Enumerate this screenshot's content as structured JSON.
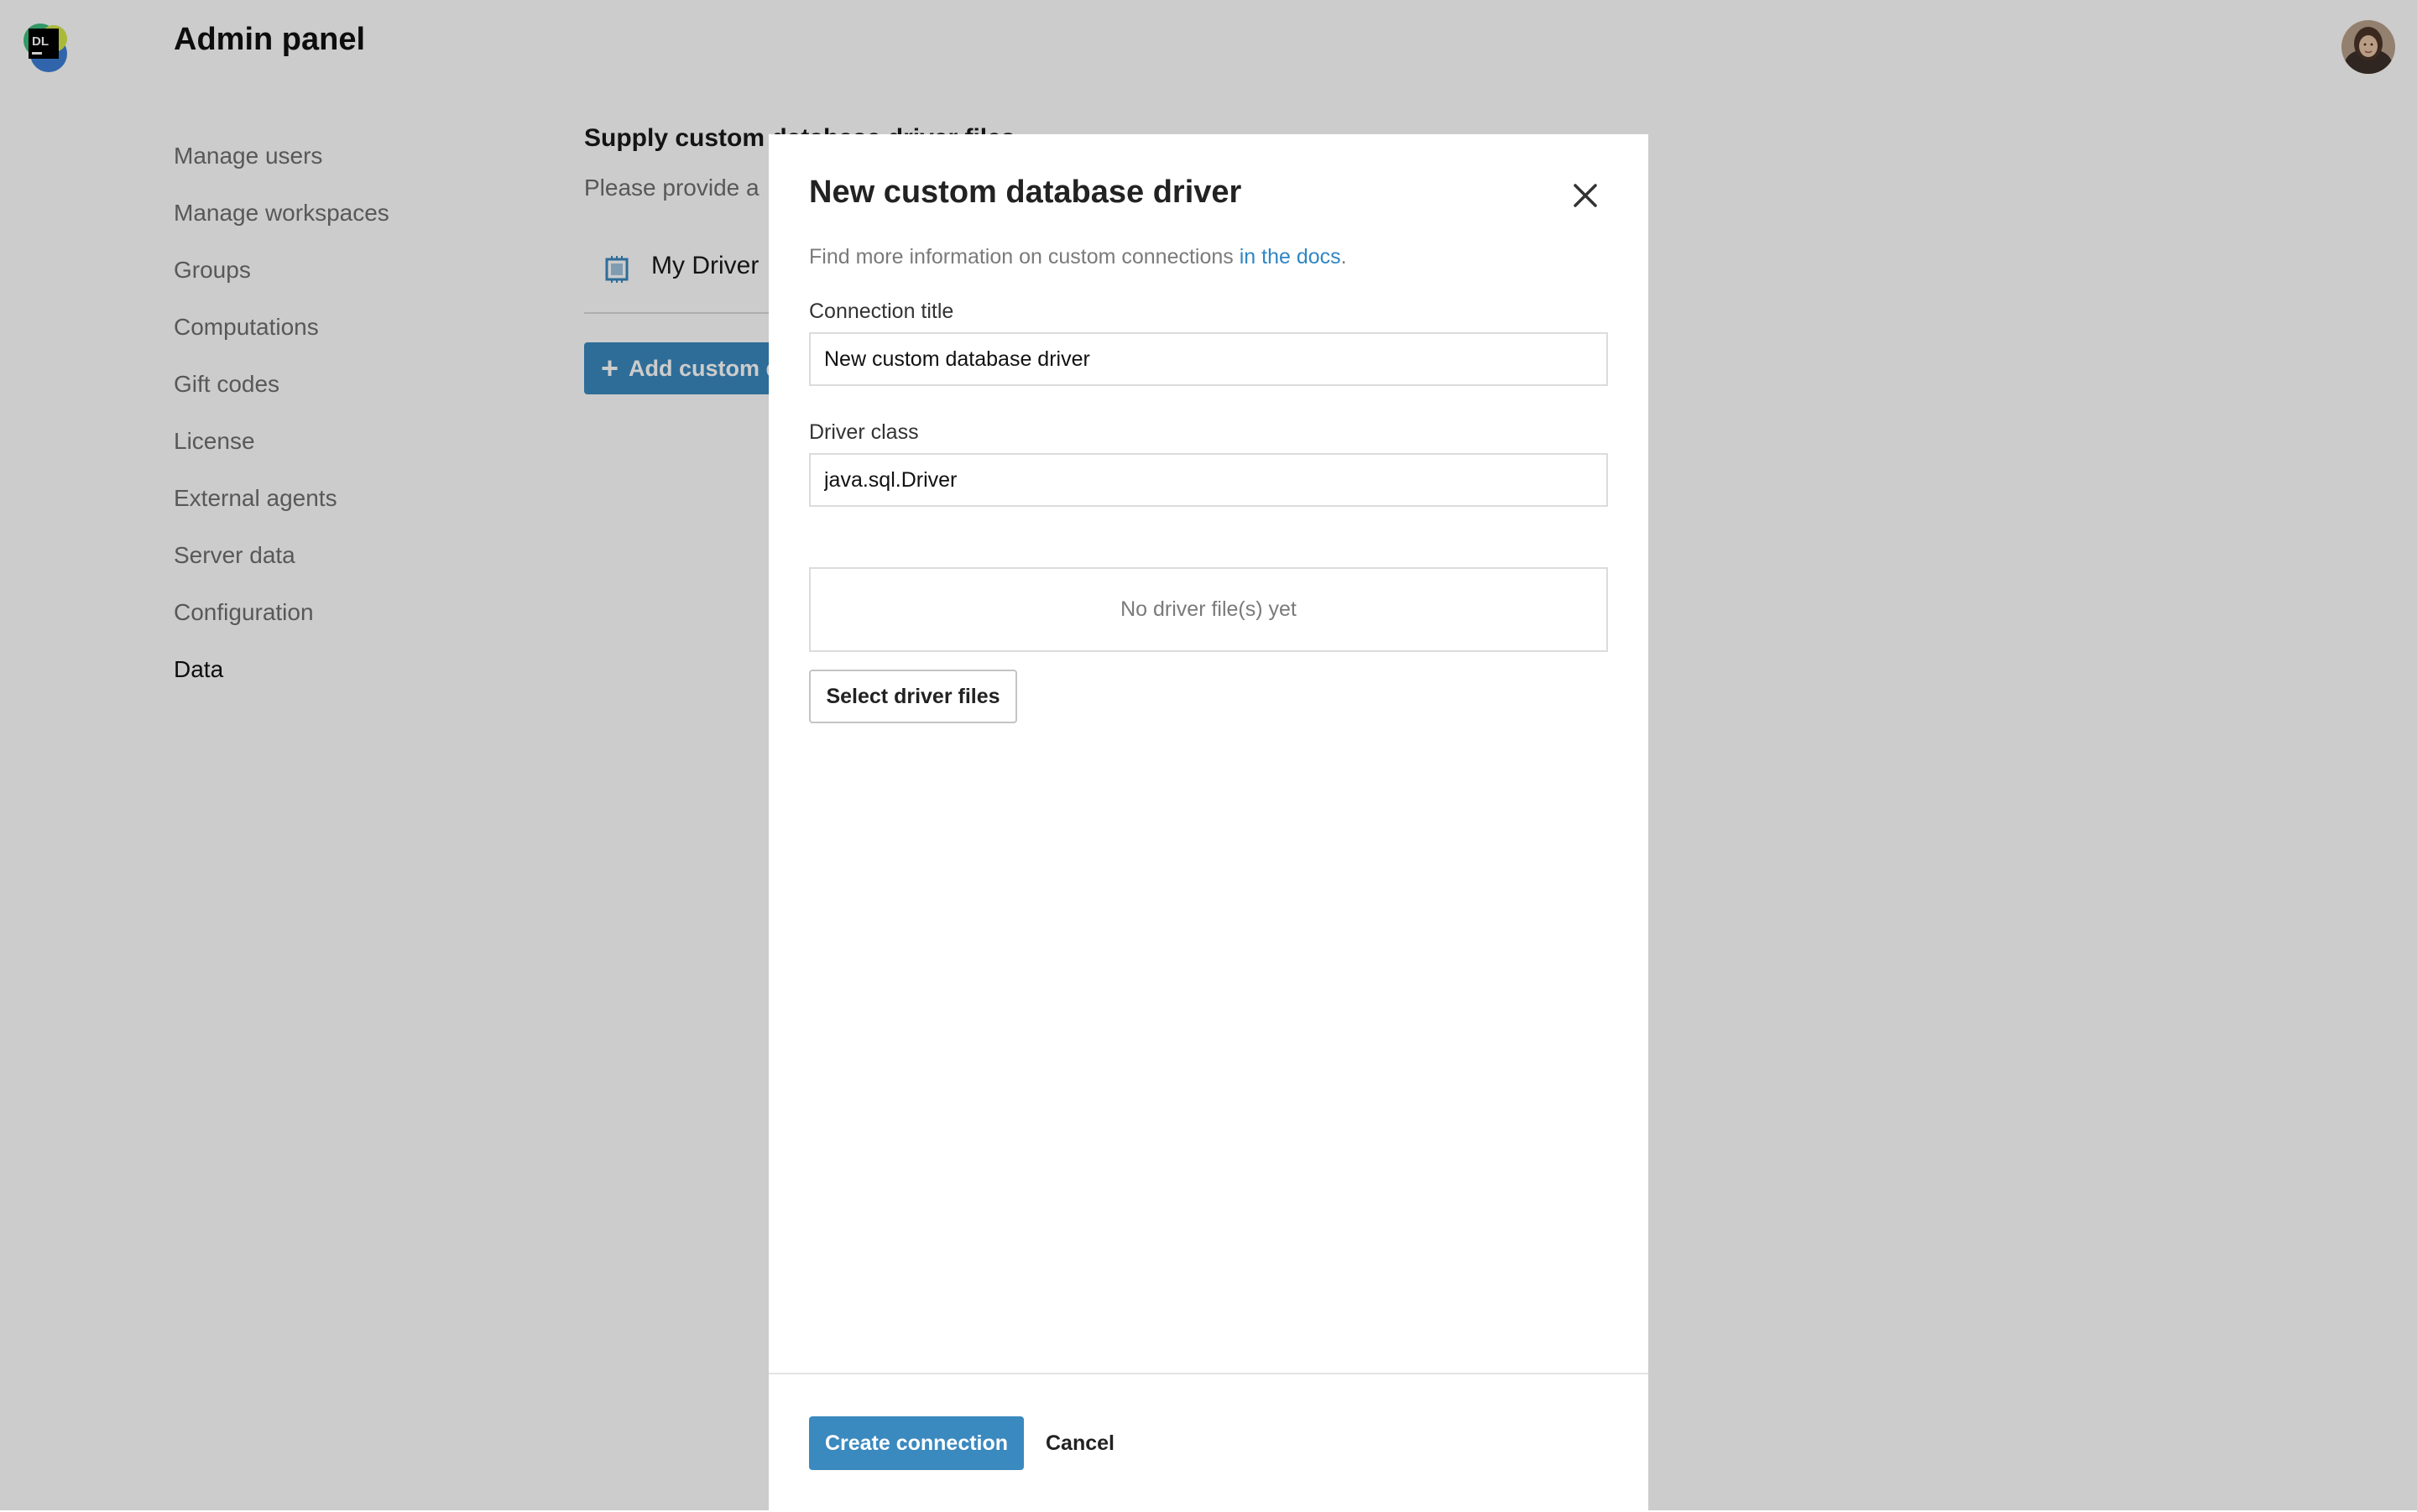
{
  "header": {
    "logo_text": "DL",
    "title": "Admin panel",
    "logo_icon": "datalore-logo-icon",
    "avatar_icon": "user-avatar"
  },
  "sidebar": {
    "items": [
      {
        "label": "Manage users",
        "active": false
      },
      {
        "label": "Manage workspaces",
        "active": false
      },
      {
        "label": "Groups",
        "active": false
      },
      {
        "label": "Computations",
        "active": false
      },
      {
        "label": "Gift codes",
        "active": false
      },
      {
        "label": "License",
        "active": false
      },
      {
        "label": "External agents",
        "active": false
      },
      {
        "label": "Server data",
        "active": false
      },
      {
        "label": "Configuration",
        "active": false
      },
      {
        "label": "Data",
        "active": true
      }
    ]
  },
  "main": {
    "heading": "Supply custom database driver files",
    "subtext": "Please provide a",
    "driver_name": "My Driver",
    "add_button_label": "Add custom driver"
  },
  "dialog": {
    "title": "New custom database driver",
    "info_text": "Find more information on custom connections ",
    "info_link": "in the docs",
    "info_end": ".",
    "connection_title_label": "Connection title",
    "connection_title_value": "New custom database driver",
    "driver_class_label": "Driver class",
    "driver_class_value": "java.sql.Driver",
    "empty_files_text": "No driver file(s) yet",
    "select_files_label": "Select driver files",
    "create_label": "Create connection",
    "cancel_label": "Cancel"
  },
  "colors": {
    "accent": "#3a89bf",
    "link": "#2f86c3",
    "overlay": "rgba(0,0,0,0.2)"
  }
}
